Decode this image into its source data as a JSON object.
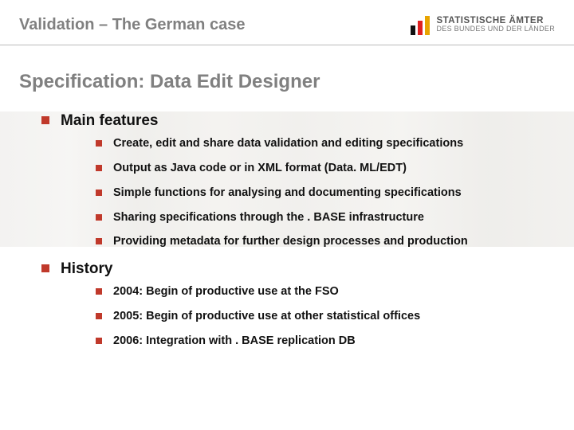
{
  "header": {
    "title": "Validation – The German case",
    "logo": {
      "line1": "STATISTISCHE ÄMTER",
      "line2": "DES BUNDES UND DER LÄNDER"
    }
  },
  "slide": {
    "title": "Specification: Data Edit Designer",
    "sections": [
      {
        "heading": "Main features",
        "items": [
          "Create, edit and share data validation and editing specifications",
          "Output as Java code or in XML format (Data. ML/EDT)",
          "Simple functions for analysing and documenting specifications",
          "Sharing specifications through the . BASE infrastructure",
          "Providing metadata for further design processes and production"
        ]
      },
      {
        "heading": "History",
        "items": [
          "2004: Begin of productive use at the FSO",
          "2005: Begin of productive use at other statistical offices",
          "2006: Integration with . BASE replication DB"
        ]
      }
    ]
  }
}
